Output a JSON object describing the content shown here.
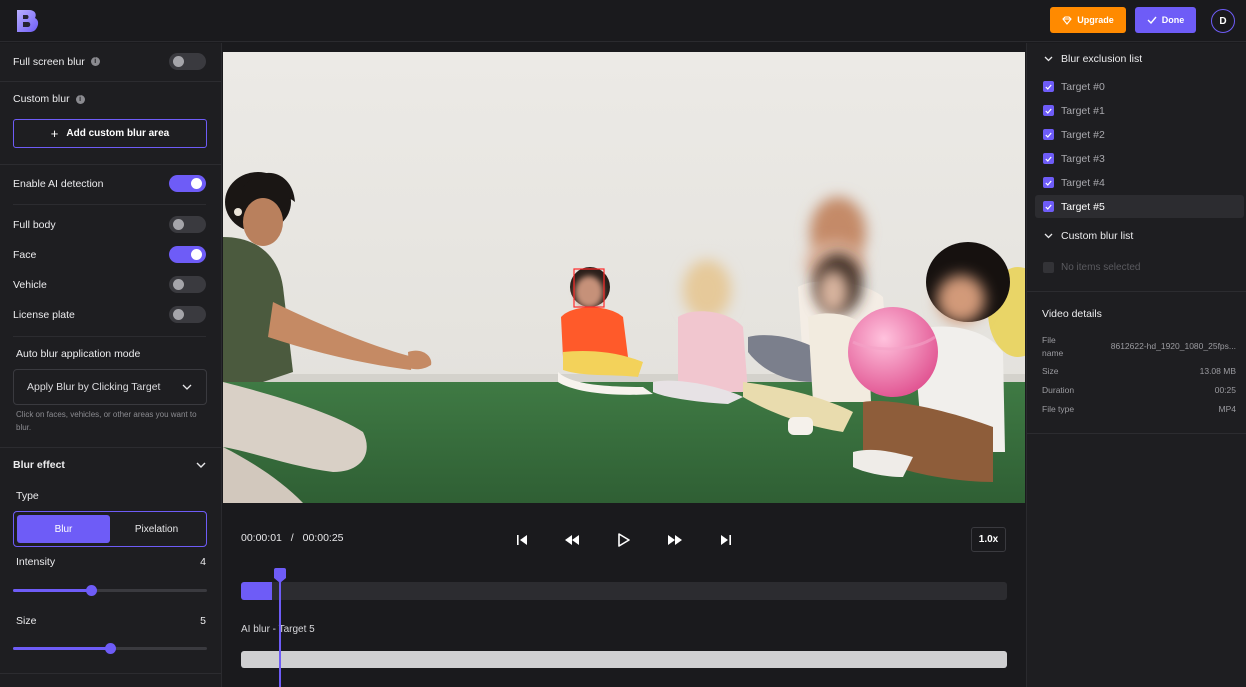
{
  "header": {
    "upgrade_label": "Upgrade",
    "done_label": "Done",
    "avatar_initial": "D",
    "accent": "#6e5cf7",
    "upgrade_color": "#ff8a00"
  },
  "left": {
    "full_screen_blur": "Full screen blur",
    "custom_blur": "Custom blur",
    "add_custom_blur_area": "Add custom blur area",
    "enable_ai_detection": "Enable AI detection",
    "full_body": "Full body",
    "face": "Face",
    "vehicle": "Vehicle",
    "license_plate": "License plate",
    "auto_blur_mode_label": "Auto blur application mode",
    "auto_blur_mode_value": "Apply Blur by Clicking Target",
    "auto_blur_hint": "Click on faces, vehicles, or other areas you want to blur.",
    "blur_effect": "Blur effect",
    "type_label": "Type",
    "type_options": [
      "Blur",
      "Pixelation"
    ],
    "intensity_label": "Intensity",
    "intensity_value": "4",
    "intensity_fraction": 0.4,
    "size_label": "Size",
    "size_value": "5",
    "size_fraction": 0.5,
    "toggles": {
      "full_screen_blur": false,
      "enable_ai_detection": true,
      "full_body": false,
      "face": true,
      "vehicle": false,
      "license_plate": false
    }
  },
  "player": {
    "current_time": "00:00:01",
    "separator": "/",
    "total_time": "00:00:25",
    "speed": "1.0x",
    "progress_fraction": 0.04,
    "track_label": "AI blur - Target 5"
  },
  "right": {
    "exclusion_title": "Blur exclusion list",
    "targets": [
      "Target #0",
      "Target #1",
      "Target #2",
      "Target #3",
      "Target #4",
      "Target #5"
    ],
    "custom_list_title": "Custom blur list",
    "no_items": "No items selected",
    "details_title": "Video details",
    "details": {
      "file_name_label": "File name",
      "file_name_value": "8612622-hd_1920_1080_25fps...",
      "size_label": "Size",
      "size_value": "13.08 MB",
      "duration_label": "Duration",
      "duration_value": "00:25",
      "file_type_label": "File type",
      "file_type_value": "MP4"
    }
  }
}
